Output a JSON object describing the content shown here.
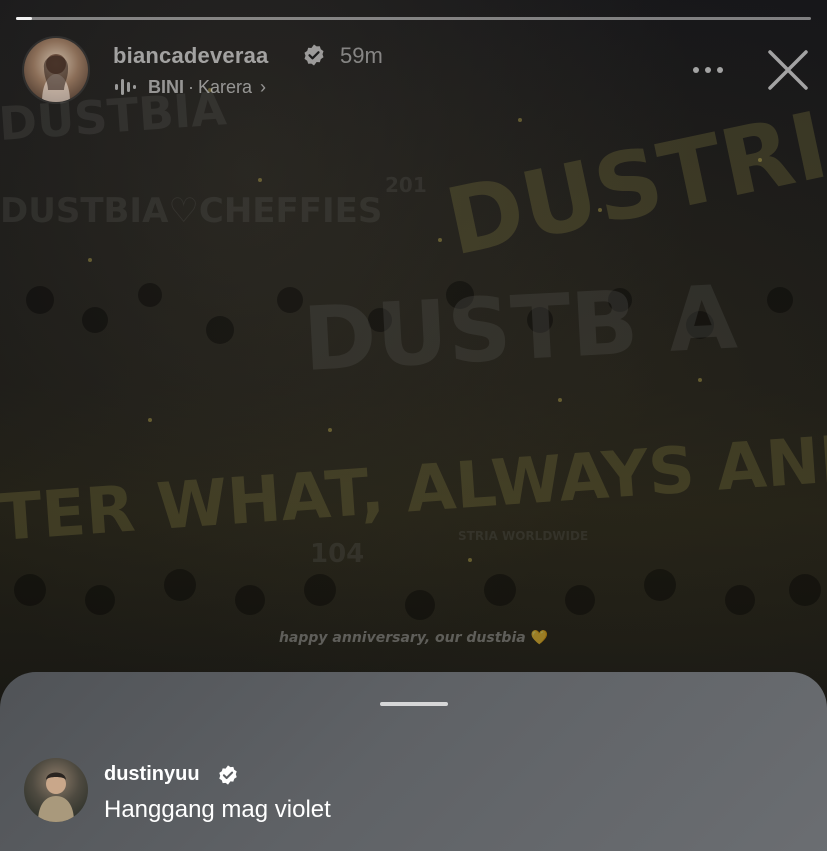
{
  "story": {
    "progress_fraction": 0.02,
    "caption_text": "happy anniversary, our dustbia",
    "caption_heart": "💛",
    "banner_texts": {
      "top_left": "DUSTBIA",
      "left": "DUSTBIA♡CHEFFIES",
      "right_big": "DUSTRIA",
      "center": "DUSTB A",
      "number_small": "201",
      "bottom_slogan": "TER WHAT, ALWAYS AND FOREV",
      "section_number": "104",
      "worldwide": "STRIA WORLDWIDE"
    }
  },
  "header": {
    "username": "biancadeveraa",
    "verified_icon": "verified-badge-icon",
    "time_ago": "59m",
    "music": {
      "icon": "audio-bars-icon",
      "artist": "BINI",
      "separator": "·",
      "song": "Karera",
      "chevron": "›"
    },
    "more_icon": "more-horizontal-icon",
    "close_icon": "close-icon"
  },
  "reply_sheet": {
    "username": "dustinyuu",
    "verified_icon": "verified-badge-icon",
    "message": "Hanggang mag violet"
  },
  "colors": {
    "sheet_background": "#5f6266",
    "caption_heart": "#d2b446",
    "verified_badge": "#ffffff"
  }
}
